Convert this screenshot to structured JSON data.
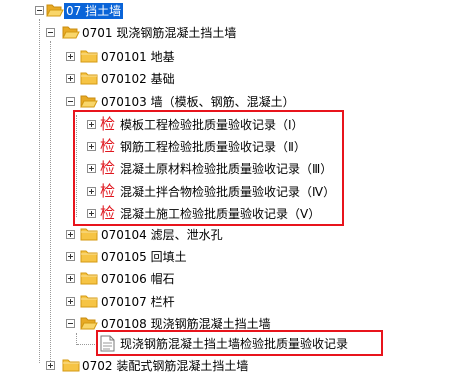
{
  "tree": {
    "root": {
      "label": "07 挡土墙"
    },
    "n0701": {
      "label": "0701 现浇钢筋混凝土挡土墙"
    },
    "n070101": {
      "label": "070101 地基"
    },
    "n070102": {
      "label": "070102 基础"
    },
    "n070103": {
      "label": "070103 墙（模板、钢筋、混凝土）"
    },
    "docs_070103": [
      {
        "icon_text": "检",
        "label": "模板工程检验批质量验收记录（Ⅰ）"
      },
      {
        "icon_text": "检",
        "label": "钢筋工程检验批质量验收记录（Ⅱ）"
      },
      {
        "icon_text": "检",
        "label": "混凝土原材料检验批质量验收记录（Ⅲ）"
      },
      {
        "icon_text": "检",
        "label": "混凝土拌合物检验批质量验收记录（Ⅳ）"
      },
      {
        "icon_text": "检",
        "label": "混凝土施工检验批质量验收记录（Ⅴ）"
      }
    ],
    "n070104": {
      "label": "070104 滤层、泄水孔"
    },
    "n070105": {
      "label": "070105 回填土"
    },
    "n070106": {
      "label": "070106 帽石"
    },
    "n070107": {
      "label": "070107 栏杆"
    },
    "n070108": {
      "label": "070108 现浇钢筋混凝土挡土墙"
    },
    "doc_070108": {
      "label": "现浇钢筋混凝土挡土墙检验批质量验收记录"
    },
    "n0702_partial": {
      "label": "0702 装配式钢筋混凝土挡土墙"
    }
  },
  "colors": {
    "selection": "#0a64d8",
    "highlight_box": "#e8141c",
    "doc_icon": "#e0171f",
    "folder": "#f6c445"
  },
  "icons": {
    "folder_closed": "folder-icon",
    "folder_open": "folder-open-icon",
    "document": "inspection-doc-icon",
    "expand": "plus-icon",
    "collapse": "minus-icon"
  }
}
